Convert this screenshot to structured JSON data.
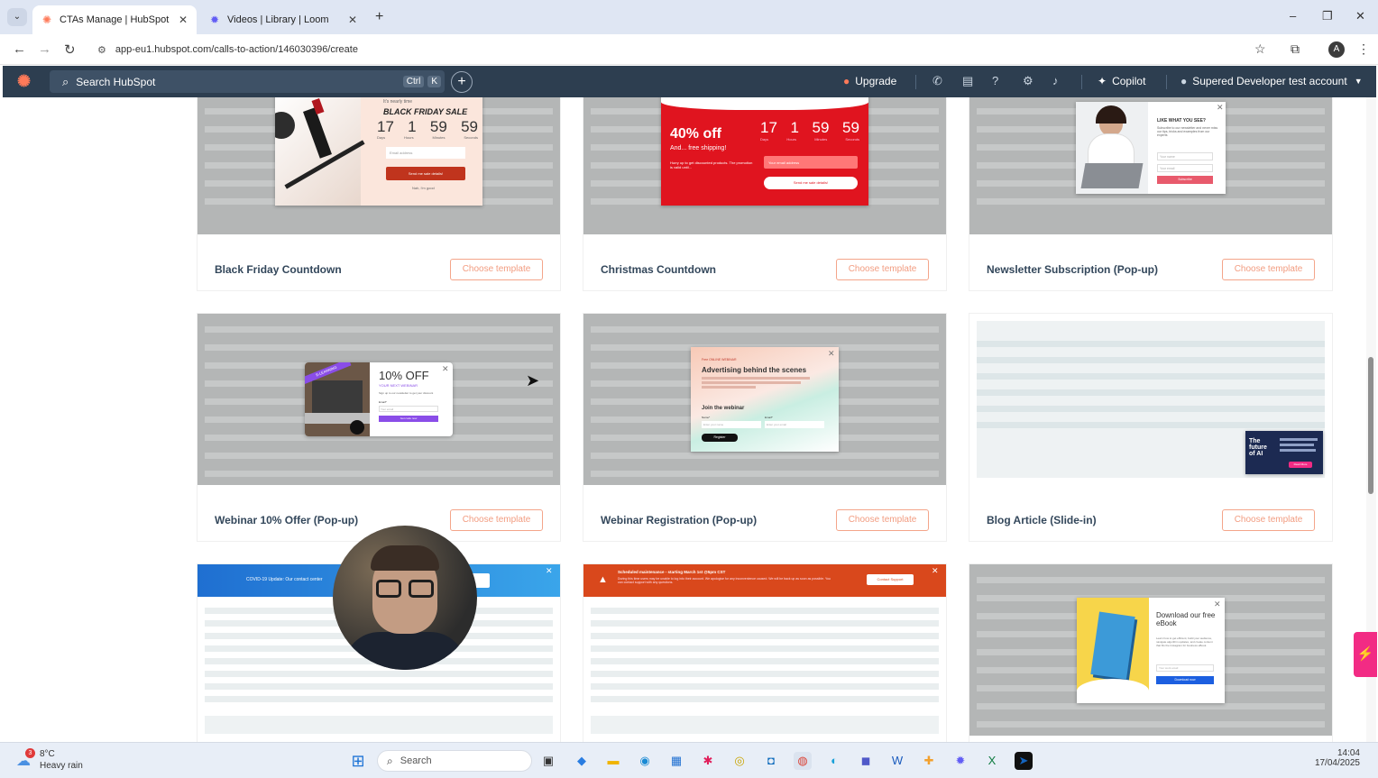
{
  "browser": {
    "tabs": [
      {
        "label": "CTAs Manage | HubSpot",
        "active": true
      },
      {
        "label": "Videos | Library | Loom",
        "active": false
      }
    ],
    "new_tab": "+",
    "url": "app-eu1.hubspot.com/calls-to-action/146030396/create",
    "profile_initial": "A",
    "window_controls": [
      "–",
      "❐",
      "✕"
    ]
  },
  "hubspot_nav": {
    "search_placeholder": "Search HubSpot",
    "shortcut_ctrl": "Ctrl",
    "shortcut_k": "K",
    "upgrade": "Upgrade",
    "copilot": "Copilot",
    "account": "Supered Developer test account"
  },
  "templates": [
    {
      "name": "Black Friday Countdown",
      "button": "Choose template"
    },
    {
      "name": "Christmas Countdown",
      "button": "Choose template"
    },
    {
      "name": "Newsletter Subscription (Pop-up)",
      "button": "Choose template"
    },
    {
      "name": "Webinar 10% Offer (Pop-up)",
      "button": "Choose template"
    },
    {
      "name": "Webinar Registration (Pop-up)",
      "button": "Choose template"
    },
    {
      "name": "Blog Article (Slide-in)",
      "button": "Choose template"
    }
  ],
  "previews": {
    "black_friday": {
      "kicker": "It's nearly time",
      "heading": "BLACK FRIDAY SALE",
      "numbers": [
        "17",
        "1",
        "59",
        "59"
      ],
      "units": [
        "Days",
        "Hours",
        "Minutes",
        "Seconds"
      ],
      "field": "Email address",
      "cta": "Send me sale details!",
      "decline": "Nah, I'm good"
    },
    "christmas": {
      "headline": "40% off",
      "sub": "And... free shipping!",
      "body": "Hurry up to get discounted products. The promotion is valid until...",
      "numbers": [
        "17",
        "1",
        "59",
        "59"
      ],
      "units": [
        "Days",
        "Hours",
        "Minutes",
        "Seconds"
      ],
      "field": "Your email address",
      "cta": "Send me sale details!"
    },
    "newsletter": {
      "heading": "LIKE WHAT YOU SEE?",
      "body": "Subscribe to our newsletter and never miss our tips, tricks and examples from our experts",
      "field1": "Your name",
      "field2": "Your email",
      "cta": "Subscribe"
    },
    "webinar_offer": {
      "ribbon": "E-LEARNING",
      "heading": "10% OFF",
      "sub": "YOUR NEXT WEBINAR",
      "body": "Sign up to our newsletter to get your discount",
      "label": "Email*",
      "field": "Your email",
      "cta": "Get code now"
    },
    "webinar_reg": {
      "kicker": "Free ONLINE WEBINAR",
      "heading": "Advertising behind the scenes",
      "join": "Join the webinar",
      "label1": "Name*",
      "label2": "Email*",
      "field1": "Enter your name",
      "field2": "Enter your email",
      "cta": "Register"
    },
    "blog": {
      "badge": "The future of AI",
      "cta": "Read More"
    },
    "covid": {
      "text": "COVID-19 Update: Our contact center"
    },
    "maintenance": {
      "title": "Scheduled maintenance - starting March 1st @5pm CST",
      "body": "During this time users may be unable to log into their account. We apologise for any inconvenience caused. We will be back up as soon as possible. You can contact support with any questions.",
      "cta": "Contact Support"
    },
    "ebook": {
      "heading": "Download our free eBook",
      "body": "Learn how to get efficient, build your audience, navigate algorithm updates, and create content that fits the Instagram for business eBook.",
      "field": "Your work email",
      "cta": "Download now"
    }
  },
  "taskbar": {
    "temperature": "8°C",
    "weather": "Heavy rain",
    "weather_badge": "3",
    "search": "Search",
    "time": "14:04",
    "date": "17/04/2025"
  },
  "colors": {
    "hubspot_nav": "#2d3e50",
    "accent_orange": "#ff7a59",
    "choose_border": "#f4a58a",
    "christmas_red": "#e0141f",
    "pink_tab": "#f22b84"
  }
}
